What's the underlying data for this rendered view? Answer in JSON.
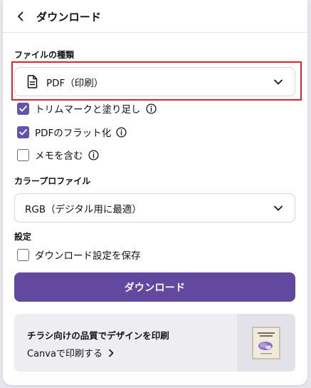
{
  "header": {
    "title": "ダウンロード"
  },
  "file_type": {
    "label": "ファイルの種類",
    "selected": "PDF（印刷）"
  },
  "options": [
    {
      "label": "トリムマークと塗り足し",
      "checked": true
    },
    {
      "label": "PDFのフラット化",
      "checked": true
    },
    {
      "label": "メモを含む",
      "checked": false
    }
  ],
  "color_profile": {
    "label": "カラープロファイル",
    "selected": "RGB（デジタル用に最適）"
  },
  "settings": {
    "label": "設定",
    "save_label": "ダウンロード設定を保存",
    "save_checked": false
  },
  "download_button": "ダウンロード",
  "promo": {
    "title": "チラシ向けの品質でデザインを印刷",
    "link": "Canvaで印刷する"
  },
  "colors": {
    "accent": "#62489e",
    "checkbox": "#6453ac",
    "highlight": "#d9232d"
  }
}
